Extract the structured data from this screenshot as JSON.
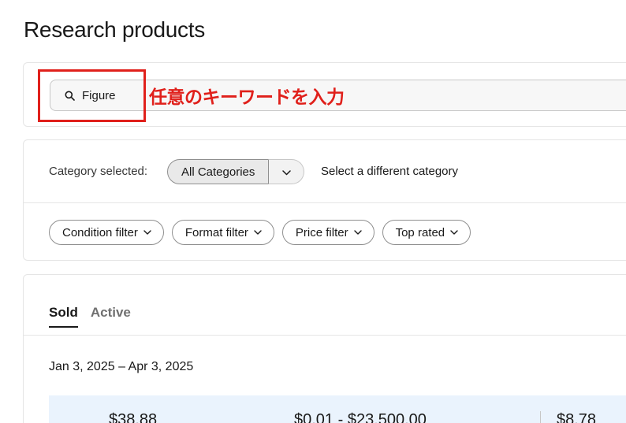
{
  "page": {
    "title": "Research products"
  },
  "search": {
    "value": "Figure",
    "icon": "search-icon"
  },
  "annotation": {
    "text": "任意のキーワードを入力",
    "color": "#e0201b"
  },
  "category": {
    "label": "Category selected:",
    "selected": "All Categories",
    "change_link": "Select a different category"
  },
  "filters": [
    {
      "label": "Condition filter"
    },
    {
      "label": "Format filter"
    },
    {
      "label": "Price filter"
    },
    {
      "label": "Top rated"
    }
  ],
  "tabs": {
    "sold": "Sold",
    "active": "Active",
    "selected": "Sold"
  },
  "results": {
    "date_range": "Jan 3, 2025 – Apr 3, 2025",
    "stats": [
      "$38.88",
      "$0.01 - $23,500.00",
      "$8.78"
    ]
  },
  "colors": {
    "stats_band": "#eaf3fd",
    "highlight": "#e0201b"
  }
}
